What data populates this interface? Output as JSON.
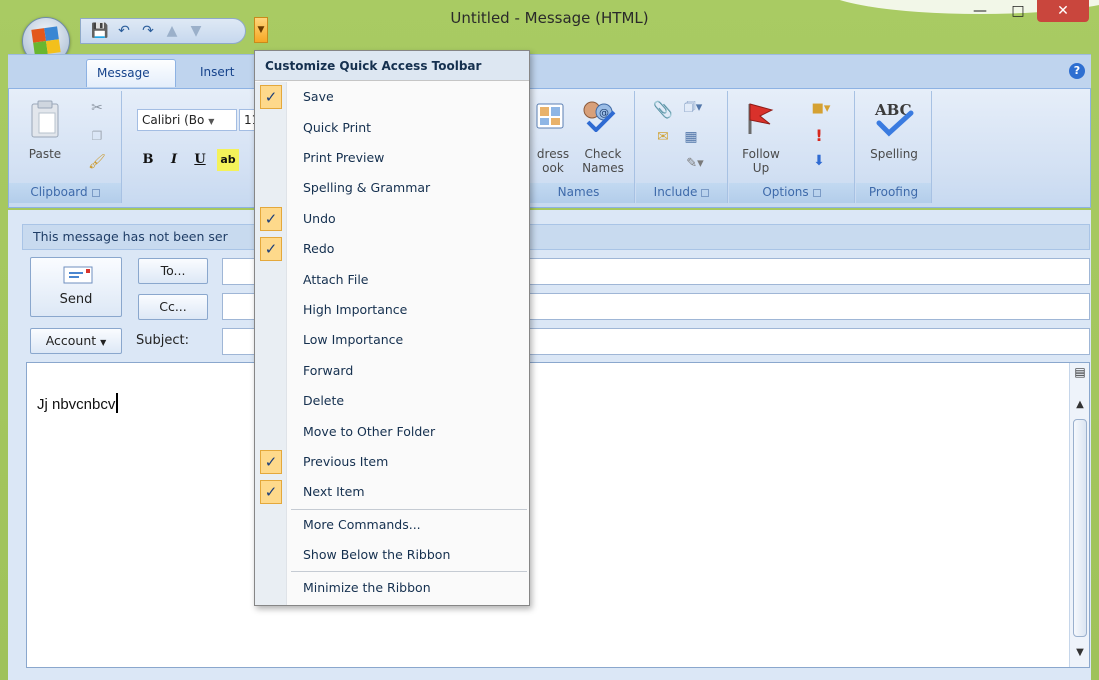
{
  "window": {
    "title": "Untitled - Message (HTML)"
  },
  "ribbon": {
    "tabs": [
      {
        "label": "Message"
      },
      {
        "label": "Insert"
      }
    ],
    "clipboard": {
      "paste_label": "Paste",
      "group_label": "Clipboard"
    },
    "basic_text": {
      "font_name": "Calibri (Bo",
      "font_size": "11"
    },
    "names": {
      "address_book_label": "dress\nook",
      "check_names_label": "Check\nNames",
      "group_label": "Names"
    },
    "include": {
      "group_label": "Include"
    },
    "options": {
      "follow_up_label": "Follow\nUp",
      "group_label": "Options"
    },
    "proofing": {
      "spelling_label": "Spelling",
      "group_label": "Proofing"
    }
  },
  "message": {
    "notice": "This message has not been ser",
    "send_label": "Send",
    "to_label": "To...",
    "cc_label": "Cc...",
    "account_label": "Account",
    "subject_label": "Subject:",
    "body_text": "Jj nbvcnbcv"
  },
  "qat_menu": {
    "header": "Customize Quick Access Toolbar",
    "items": [
      {
        "label": "Save",
        "checked": true
      },
      {
        "label": "Quick Print",
        "checked": false
      },
      {
        "label": "Print Preview",
        "checked": false
      },
      {
        "label": "Spelling & Grammar",
        "checked": false
      },
      {
        "label": "Undo",
        "checked": true
      },
      {
        "label": "Redo",
        "checked": true
      },
      {
        "label": "Attach File",
        "checked": false
      },
      {
        "label": "High Importance",
        "checked": false
      },
      {
        "label": "Low Importance",
        "checked": false
      },
      {
        "label": "Forward",
        "checked": false
      },
      {
        "label": "Delete",
        "checked": false
      },
      {
        "label": "Move to Other Folder",
        "checked": false
      },
      {
        "label": "Previous Item",
        "checked": true
      },
      {
        "label": "Next Item",
        "checked": true
      },
      {
        "label": "More Commands...",
        "checked": false
      },
      {
        "label": "Show Below the Ribbon",
        "checked": false
      },
      {
        "label": "Minimize the Ribbon",
        "checked": false
      }
    ]
  },
  "colors": {
    "frame": "#a9cb63",
    "ribbon": "#d2e0f3",
    "check_highlight": "#fed98b",
    "close_button": "#c9463d"
  }
}
